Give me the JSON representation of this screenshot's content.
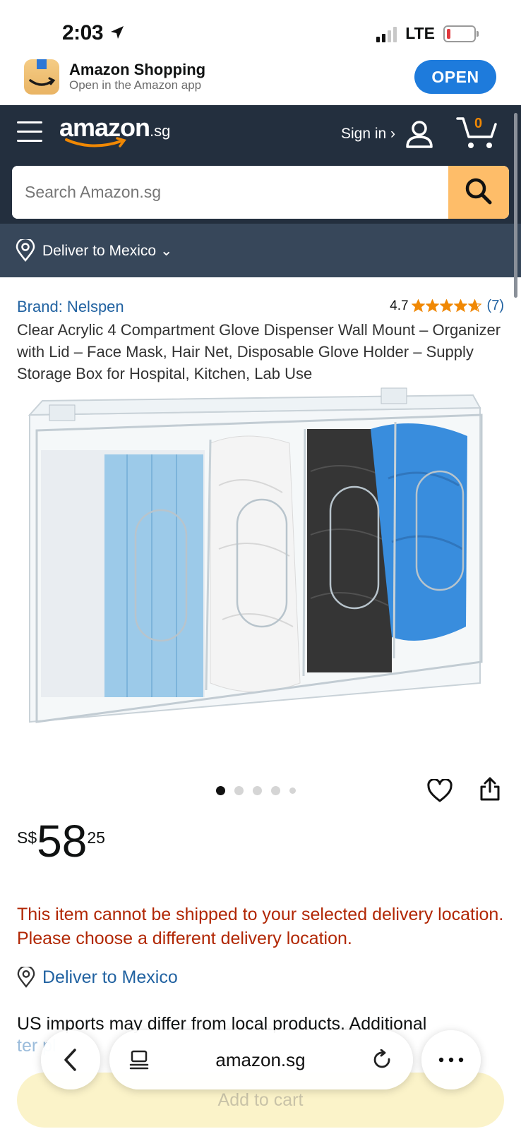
{
  "status_bar": {
    "time": "2:03",
    "network": "LTE"
  },
  "app_banner": {
    "name": "Amazon Shopping",
    "subtitle": "Open in the Amazon app",
    "button": "OPEN"
  },
  "header": {
    "logo_main": "amazon",
    "logo_suffix": ".sg",
    "signin": "Sign in ›",
    "cart_count": "0",
    "search_placeholder": "Search Amazon.sg",
    "deliver": "Deliver to Mexico ⌄"
  },
  "product": {
    "brand": "Brand: Nelspen",
    "rating_value": "4.7",
    "rating_stars": 4.7,
    "rating_count": "(7)",
    "title": "Clear Acrylic 4 Compartment Glove Dispenser Wall Mount – Organizer with Lid – Face Mask, Hair Net, Disposable Glove Holder – Supply Storage Box for Hospital, Kitchen, Lab Use",
    "image_count": 5,
    "active_image": 1,
    "price": {
      "currency": "S$",
      "whole": "58",
      "fraction": "25"
    },
    "warning": "This item cannot be shipped to your selected delivery location. Please choose a different delivery location.",
    "deliver_link": "Deliver to Mexico",
    "imports_note": "US imports may differ from local products. Additional",
    "imports_note_partial": "ter  pl"
  },
  "browser": {
    "url": "amazon.sg",
    "add_to_cart": "Add to cart"
  },
  "colors": {
    "header_bg": "#232f3e",
    "deliver_bg": "#37475a",
    "search_button": "#febd69",
    "link": "#2162a1",
    "warning": "#b12704",
    "star": "#f08804",
    "open_button": "#1e7bdc"
  },
  "icons": [
    "location-arrow-icon",
    "signal-icon",
    "battery-icon",
    "amazon-app-icon",
    "menu-icon",
    "user-icon",
    "cart-icon",
    "search-icon",
    "location-pin-icon",
    "star-icon",
    "heart-icon",
    "share-icon",
    "back-arrow-icon",
    "tabs-icon",
    "reload-icon",
    "more-icon"
  ]
}
